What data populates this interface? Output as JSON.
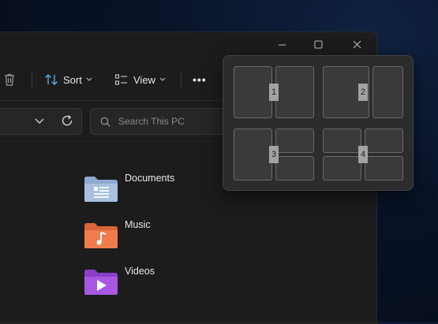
{
  "window": {
    "captions": {
      "minimize": "minimize",
      "maximize": "maximize",
      "close": "close"
    }
  },
  "toolbar": {
    "sort_label": "Sort",
    "view_label": "View",
    "more_label": "•••"
  },
  "search": {
    "placeholder": "Search This PC"
  },
  "folders": [
    {
      "label": "Documents",
      "icon": "documents-folder-icon"
    },
    {
      "label": "Music",
      "icon": "music-folder-icon"
    },
    {
      "label": "Videos",
      "icon": "videos-folder-icon"
    }
  ],
  "snap_layouts": {
    "layouts": [
      {
        "number": "1"
      },
      {
        "number": "2"
      },
      {
        "number": "3"
      },
      {
        "number": "4"
      }
    ]
  },
  "colors": {
    "window_bg": "#1c1c1c",
    "flyout_bg": "#2c2c2c",
    "zone_bg": "#3a3a3a",
    "zone_label_bg": "#a3a3a3"
  }
}
